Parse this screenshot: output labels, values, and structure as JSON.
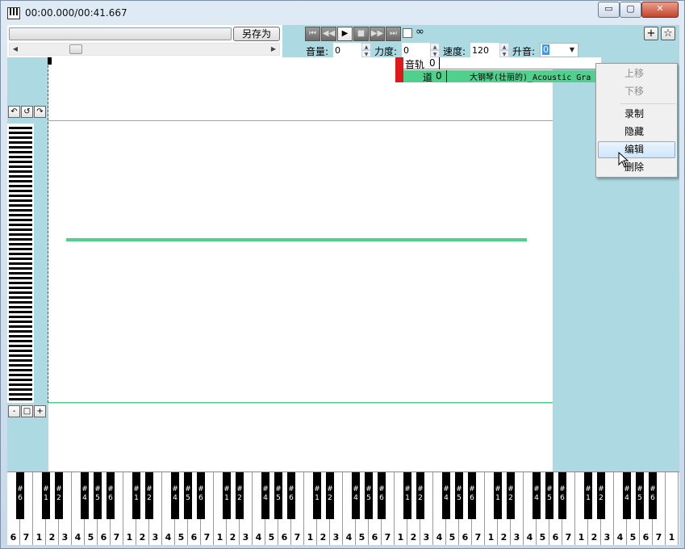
{
  "window": {
    "title": "00:00.000/00:41.667",
    "minimize_glyph": "▭",
    "maximize_glyph": "▢",
    "close_glyph": "✕"
  },
  "toolbar": {
    "save_as_label": "另存为",
    "transport": {
      "first_glyph": "⏮",
      "rewind_glyph": "◀◀",
      "play_glyph": "▶",
      "stop_glyph": "■",
      "forward_glyph": "▶▶",
      "last_glyph": "⏭"
    },
    "loop_glyph": "∞",
    "volume_label": "音量:",
    "volume_value": "0",
    "velocity_label": "力度:",
    "velocity_value": "0",
    "speed_label": "速度:",
    "speed_value": "120",
    "transpose_label": "升音:",
    "transpose_value": "0",
    "add_glyph": "+",
    "star_glyph": "☆"
  },
  "editor_tools": {
    "undo_glyph": "↶",
    "reset_glyph": "↺",
    "redo_glyph": "↷",
    "zoom_out_glyph": "-",
    "zoom_fit_glyph": "□",
    "zoom_in_glyph": "+"
  },
  "tracks": {
    "header_label": "音轨",
    "header_value": "0",
    "channel_label": "道",
    "channel_value": "0",
    "instrument": "大钢琴(壮丽的)_Acoustic Gra"
  },
  "context_menu": {
    "items": [
      {
        "label": "上移",
        "disabled": true
      },
      {
        "label": "下移",
        "disabled": true
      },
      {
        "label": "录制",
        "disabled": false
      },
      {
        "label": "隐藏",
        "disabled": false
      },
      {
        "label": "编辑",
        "disabled": false,
        "highlighted": true
      },
      {
        "label": "删除",
        "disabled": false
      }
    ]
  },
  "keyboard": {
    "white_keys": [
      "6",
      "7",
      "1",
      "2",
      "3",
      "4",
      "5",
      "6",
      "7",
      "1",
      "2",
      "3",
      "4",
      "5",
      "6",
      "7",
      "1",
      "2",
      "3",
      "4",
      "5",
      "6",
      "7",
      "1",
      "2",
      "3",
      "4",
      "5",
      "6",
      "7",
      "1",
      "2",
      "3",
      "4",
      "5",
      "6",
      "7",
      "1",
      "2",
      "3",
      "4",
      "5",
      "6",
      "7",
      "1",
      "2",
      "3",
      "4",
      "5",
      "6",
      "7",
      "1"
    ],
    "black_keys": [
      "6",
      "1",
      "2",
      "4",
      "5",
      "6",
      "1",
      "2",
      "4",
      "5",
      "6",
      "1",
      "2",
      "4",
      "5",
      "6",
      "1",
      "2",
      "4",
      "5",
      "6",
      "1",
      "2",
      "4",
      "5",
      "6",
      "1",
      "2",
      "4",
      "5",
      "6",
      "1",
      "2",
      "4",
      "5",
      "6"
    ],
    "sharp_glyph": "#"
  },
  "colors": {
    "accent_green": "#4fd08d",
    "track_red": "#e01818",
    "client_bg": "#add9e3"
  }
}
